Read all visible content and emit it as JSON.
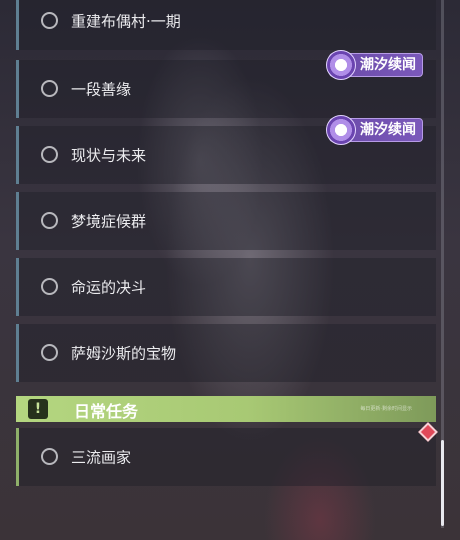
{
  "quests": [
    {
      "label": "重建布偶村·一期"
    },
    {
      "label": "一段善缘",
      "badge": "潮汐续闻"
    },
    {
      "label": "现状与未来",
      "badge": "潮汐续闻"
    },
    {
      "label": "梦境症候群"
    },
    {
      "label": "命运的决斗"
    },
    {
      "label": "萨姆沙斯的宝物"
    }
  ],
  "daily_section": {
    "icon": "!",
    "title": "日常任务",
    "small_text": "每日更新·剩余时间显示"
  },
  "daily_quests": [
    {
      "label": "三流画家"
    }
  ],
  "colors": {
    "accent_blue_bar": "#5f7f92",
    "daily_green": "#a8c974",
    "badge_purple": "#7b59bb",
    "alert_red": "#e04a5a"
  },
  "scroll": {
    "position_fraction": 0.9
  }
}
